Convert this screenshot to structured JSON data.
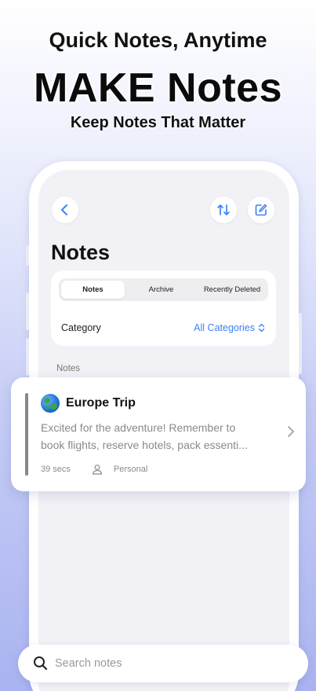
{
  "hero": {
    "line1": "Quick Notes, Anytime",
    "line2": "MAKE Notes",
    "line3": "Keep Notes That Matter"
  },
  "nav": {
    "back_icon": "chevron-left-icon",
    "sort_icon": "sort-arrows-icon",
    "compose_icon": "compose-icon"
  },
  "page": {
    "title": "Notes"
  },
  "segments": [
    {
      "label": "Notes",
      "selected": true
    },
    {
      "label": "Archive",
      "selected": false
    },
    {
      "label": "Recently Deleted",
      "selected": false
    }
  ],
  "category": {
    "label": "Category",
    "value": "All Categories"
  },
  "section": {
    "label": "Notes"
  },
  "note": {
    "emoji": "globe-icon",
    "title": "Europe Trip",
    "preview_line1": "Excited for the adventure! Remember to",
    "preview_line2": "book flights, reserve hotels, pack essenti...",
    "time": "39 secs",
    "category": "Personal"
  },
  "search": {
    "placeholder": "Search notes"
  },
  "colors": {
    "accent": "#3b82f6",
    "muted": "#8a8a8f",
    "note_bar": "#888888"
  }
}
